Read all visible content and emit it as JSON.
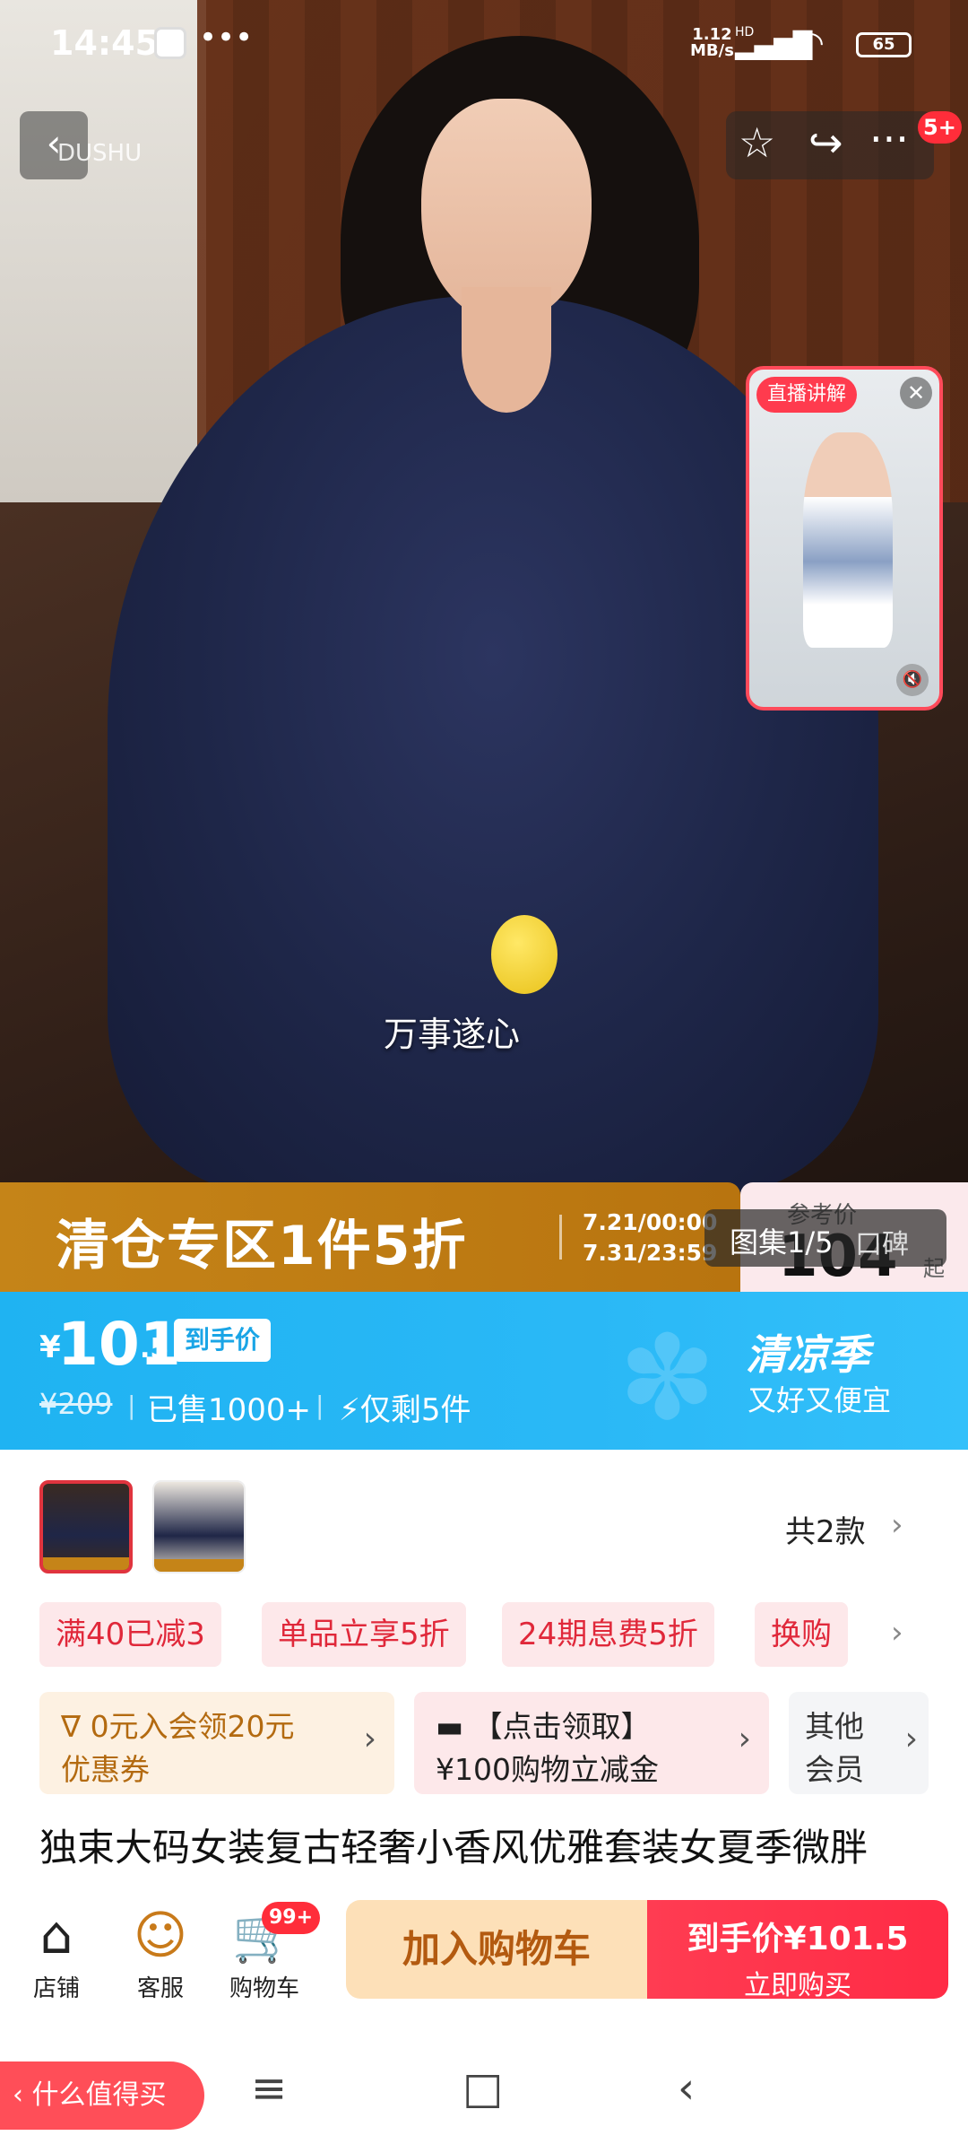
{
  "status_bar": {
    "time": "14:45",
    "dots": "•••",
    "net_speed_value": "1.12",
    "net_speed_unit": "MB/s",
    "hd": "HD",
    "battery": "65",
    "signal_icon": "signal-icon",
    "wifi_icon": "wifi-icon"
  },
  "top_bar": {
    "back_icon": "‹",
    "brand": "DUSHU",
    "favorite_icon": "☆",
    "share_icon": "↪",
    "more_icon": "···",
    "message_badge": "5+"
  },
  "hero": {
    "caption": "万事遂心"
  },
  "live_window": {
    "tag": "直播讲解",
    "close": "✕",
    "mute": "🔇"
  },
  "clearance_banner": {
    "title": "清仓专区1件5折",
    "date_start": "7.21/00:00",
    "date_end": "7.31/23:59"
  },
  "reference_price": {
    "label": "参考价",
    "value": "104",
    "suffix": "起"
  },
  "gallery": {
    "label": "图集1/5",
    "reviews": "口碑"
  },
  "price_band": {
    "currency": "¥",
    "price_int": "101",
    "price_dec": ".5",
    "price_tag": "到手价",
    "original_price": "¥209",
    "sold": "已售1000+",
    "stock": "⚡仅剩5件",
    "season_title": "清凉季",
    "season_sub": "又好又便宜",
    "separator": "|"
  },
  "variants": {
    "count_label": "共2款",
    "chevron": "›"
  },
  "promo_chips": [
    "满40已减3",
    "单品立享5折",
    "24期息费5折",
    "换购"
  ],
  "promo_chevron": "›",
  "coupons": {
    "membership": {
      "line1": "∇ 0元入会领20元",
      "line2": "优惠券",
      "arrow": "›"
    },
    "cash": {
      "line1": "▬ 【点击领取】",
      "line2": "¥100购物立减金",
      "arrow": "›"
    },
    "other": {
      "line1": "其他",
      "line2": "会员",
      "arrow": "›"
    }
  },
  "product": {
    "title": "独束大码女装复古轻奢小香风优雅套装女夏季微胖"
  },
  "action_bar": {
    "shop_label": "店铺",
    "service_label": "客服",
    "cart_label": "购物车",
    "cart_badge": "99+",
    "add_to_cart": "加入购物车",
    "buy_price": "到手价¥101.5",
    "buy_now": "立即购买"
  },
  "system_nav": {
    "worth_buying": "‹ 什么值得买",
    "menu_icon": "≡",
    "home_icon": "□",
    "back_icon": "‹"
  },
  "colors": {
    "accent_red": "#ff2b45",
    "price_blue": "#1fb3f2",
    "clearance_gold": "#c58418"
  }
}
